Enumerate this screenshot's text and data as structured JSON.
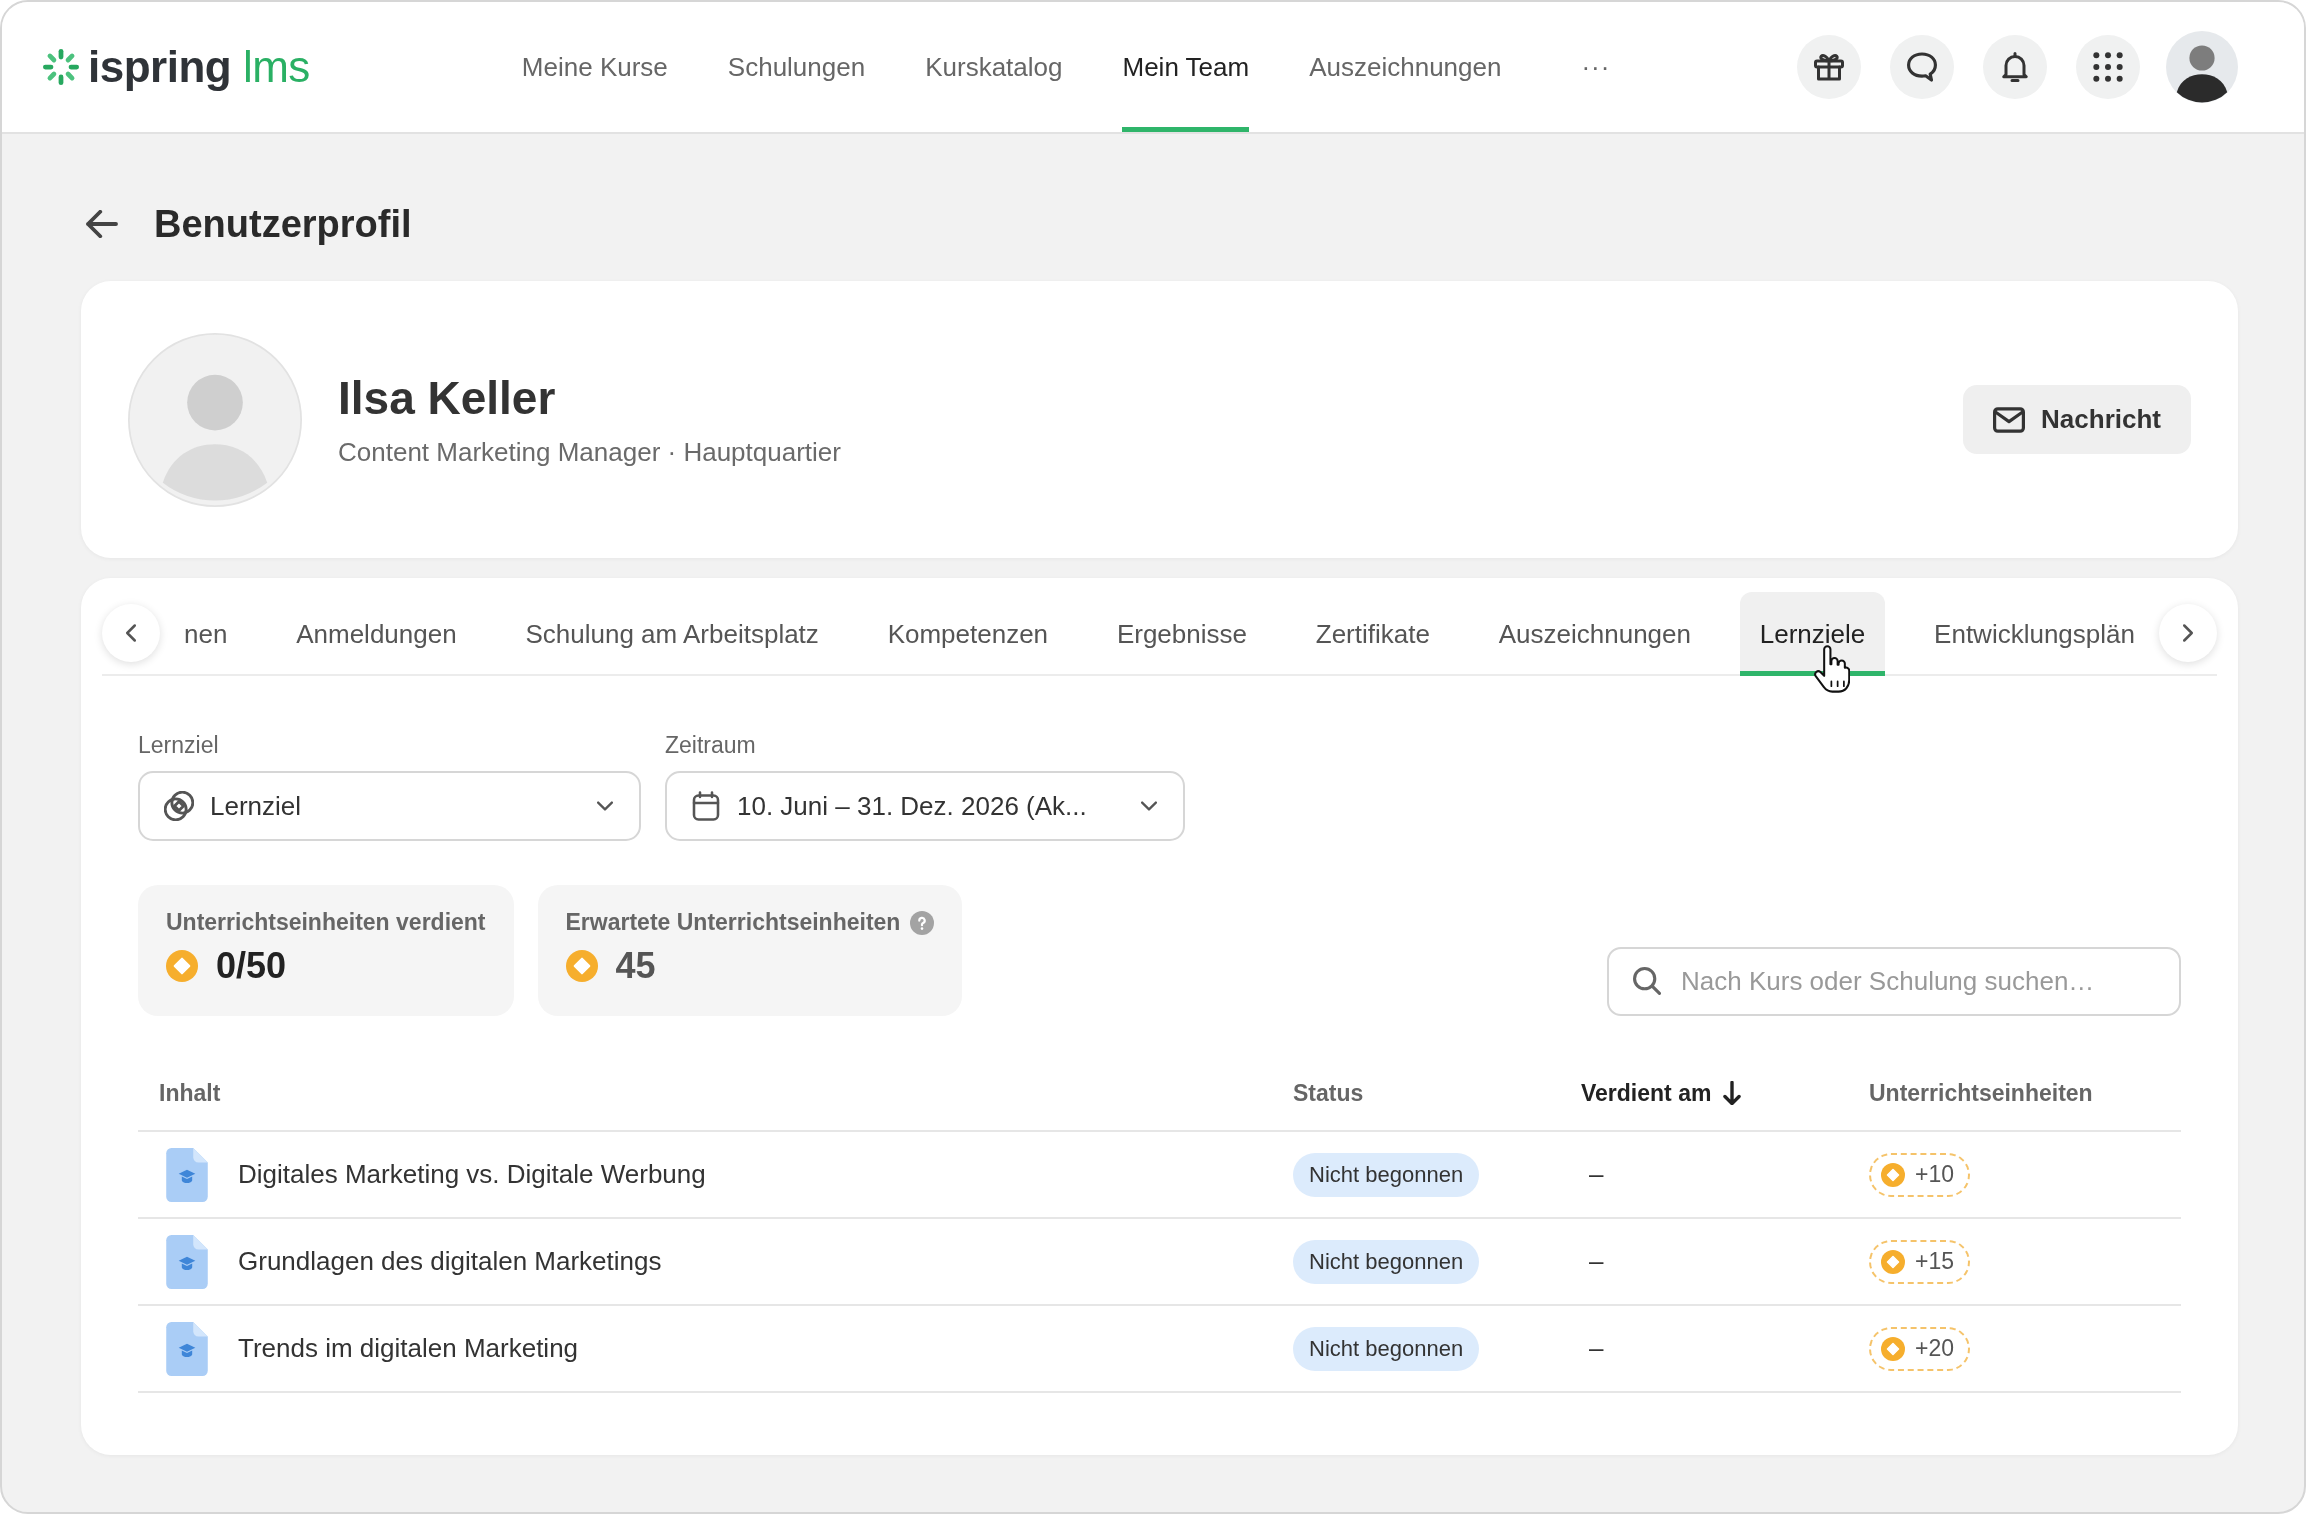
{
  "header": {
    "logo": {
      "brand": "ispring",
      "product": "lms"
    },
    "nav": [
      {
        "label": "Meine Kurse",
        "selected": false
      },
      {
        "label": "Schulungen",
        "selected": false
      },
      {
        "label": "Kurskatalog",
        "selected": false
      },
      {
        "label": "Mein Team",
        "selected": true
      },
      {
        "label": "Auszeichnungen",
        "selected": false
      }
    ],
    "more": "···"
  },
  "page": {
    "title": "Benutzerprofil"
  },
  "profile": {
    "name": "Ilsa Keller",
    "subtitle": "Content Marketing Manager · Hauptquartier",
    "button": "Nachricht"
  },
  "tabs": [
    {
      "label": "nen",
      "selected": false
    },
    {
      "label": "Anmeldungen",
      "selected": false
    },
    {
      "label": "Schulung am Arbeitsplatz",
      "selected": false
    },
    {
      "label": "Kompetenzen",
      "selected": false
    },
    {
      "label": "Ergebnisse",
      "selected": false
    },
    {
      "label": "Zertifikate",
      "selected": false
    },
    {
      "label": "Auszeichnungen",
      "selected": false
    },
    {
      "label": "Lernziele",
      "selected": true
    },
    {
      "label": "Entwicklungsplän",
      "selected": false
    }
  ],
  "filters": [
    {
      "kind": "goal",
      "label": "Lernziel",
      "value": "Lernziel"
    },
    {
      "kind": "date",
      "label": "Zeitraum",
      "value": "10. Juni – 31. Dez. 2026 (Ak..."
    }
  ],
  "stats": [
    {
      "label": "Unterrichtseinheiten verdient",
      "value": "0/50",
      "help": false,
      "muted": false
    },
    {
      "label": "Erwartete Unterrichtseinheiten",
      "value": "45",
      "help": true,
      "muted": true
    }
  ],
  "search": {
    "placeholder": "Nach Kurs oder Schulung suchen…"
  },
  "table": {
    "columns": [
      {
        "label": "Inhalt",
        "sorted": false
      },
      {
        "label": "Status",
        "sorted": false
      },
      {
        "label": "Verdient am",
        "sorted": true
      },
      {
        "label": "Unterrichtseinheiten",
        "sorted": false
      }
    ],
    "rows": [
      {
        "title": "Digitales Marketing vs. Digitale Werbung",
        "status": "Nicht begonnen",
        "earned_on": "–",
        "units": "+10"
      },
      {
        "title": "Grundlagen des digitalen Marketings",
        "status": "Nicht begonnen",
        "earned_on": "–",
        "units": "+15"
      },
      {
        "title": "Trends im digitalen Marketing",
        "status": "Nicht begonnen",
        "earned_on": "–",
        "units": "+20"
      }
    ]
  }
}
